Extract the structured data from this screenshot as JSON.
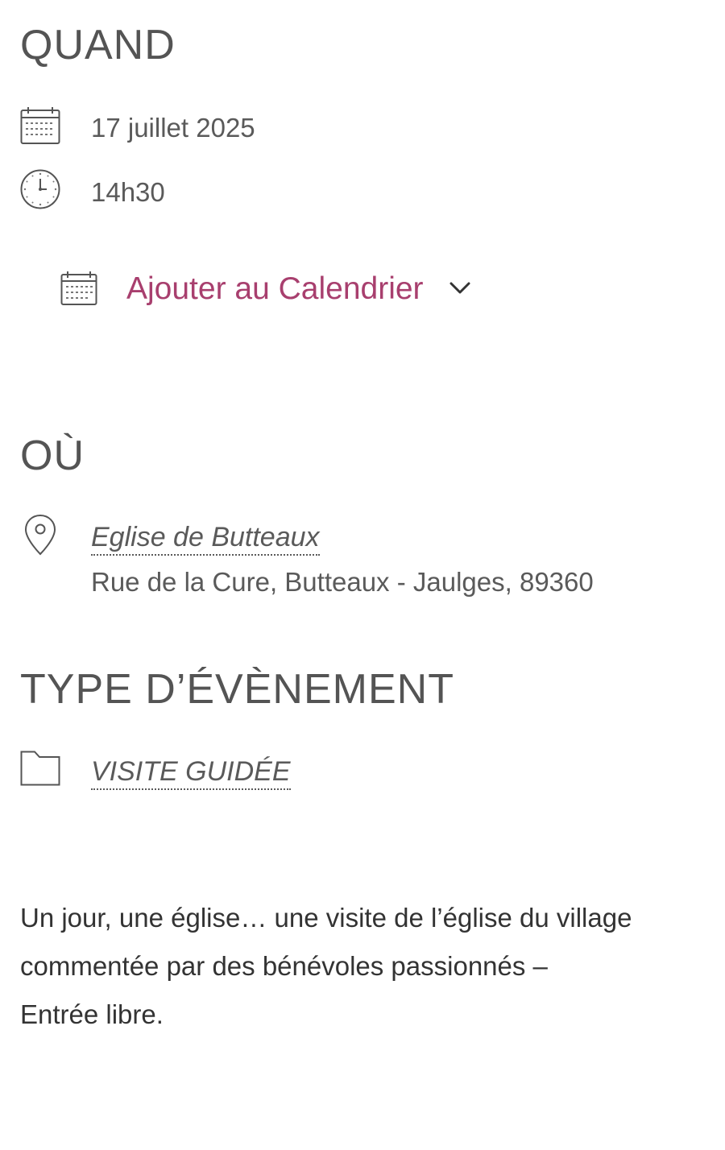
{
  "when": {
    "heading": "QUAND",
    "date_icon": "calendar-icon",
    "date": "17 juillet 2025",
    "time_icon": "clock-icon",
    "time": "14h30",
    "add_to_calendar": {
      "icon": "calendar-icon",
      "label": "Ajouter au Calendrier",
      "chevron": "chevron-down-icon"
    }
  },
  "where": {
    "heading": "OÙ",
    "icon": "map-pin-icon",
    "venue": "Eglise de Butteaux",
    "address": "Rue de la Cure, Butteaux - Jaulges, 89360"
  },
  "event_type": {
    "heading": "TYPE D’ÉVÈNEMENT",
    "icon": "folder-icon",
    "category": "VISITE GUIDÉE"
  },
  "description": {
    "line1": "Un jour, une église… une visite de l’église du village commentée par des bénévoles passionnés –",
    "line2": "Entrée libre."
  },
  "colors": {
    "text": "#555555",
    "accent": "#a83f6e"
  }
}
